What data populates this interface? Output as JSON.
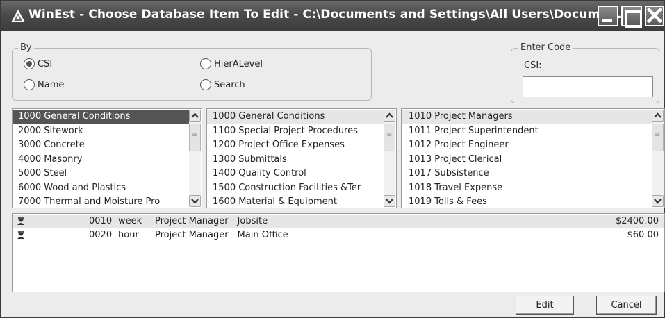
{
  "window": {
    "title": "WinEst - Choose Database Item To Edit - C:\\Documents and Settings\\All Users\\Docume..."
  },
  "by_group": {
    "legend": "By",
    "options": [
      {
        "label": "CSI",
        "selected": true
      },
      {
        "label": "HierALevel",
        "selected": false
      },
      {
        "label": "Name",
        "selected": false
      },
      {
        "label": "Search",
        "selected": false
      }
    ]
  },
  "code_group": {
    "legend": "Enter Code",
    "label": "CSI:",
    "value": ""
  },
  "list1": {
    "items": [
      "1000 General Conditions",
      "2000 Sitework",
      "3000 Concrete",
      "4000 Masonry",
      "5000 Steel",
      "6000 Wood and Plastics",
      "7000 Thermal and Moisture Pro"
    ],
    "selected_index": 0
  },
  "list2": {
    "items": [
      "1000 General Conditions",
      "1100 Special Project Procedures",
      "1200 Project Office Expenses",
      "1300 Submittals",
      "1400 Quality Control",
      "1500 Construction Facilities &Ter",
      "1600 Material & Equipment"
    ],
    "selected_index": 0
  },
  "list3": {
    "items": [
      "1010 Project Managers",
      "1011 Project Superintendent",
      "1012 Project Engineer",
      "1013 Project Clerical",
      "1017 Subsistence",
      "1018 Travel Expense",
      "1019 Tolls & Fees"
    ],
    "selected_index": 0
  },
  "details": [
    {
      "icon": "worker-icon",
      "code": "0010",
      "unit": "week",
      "description": "Project Manager - Jobsite",
      "cost": "$2400.00"
    },
    {
      "icon": "worker-icon",
      "code": "0020",
      "unit": "hour",
      "description": "Project Manager - Main Office",
      "cost": "$60.00"
    }
  ],
  "buttons": {
    "edit": "Edit",
    "cancel": "Cancel"
  }
}
